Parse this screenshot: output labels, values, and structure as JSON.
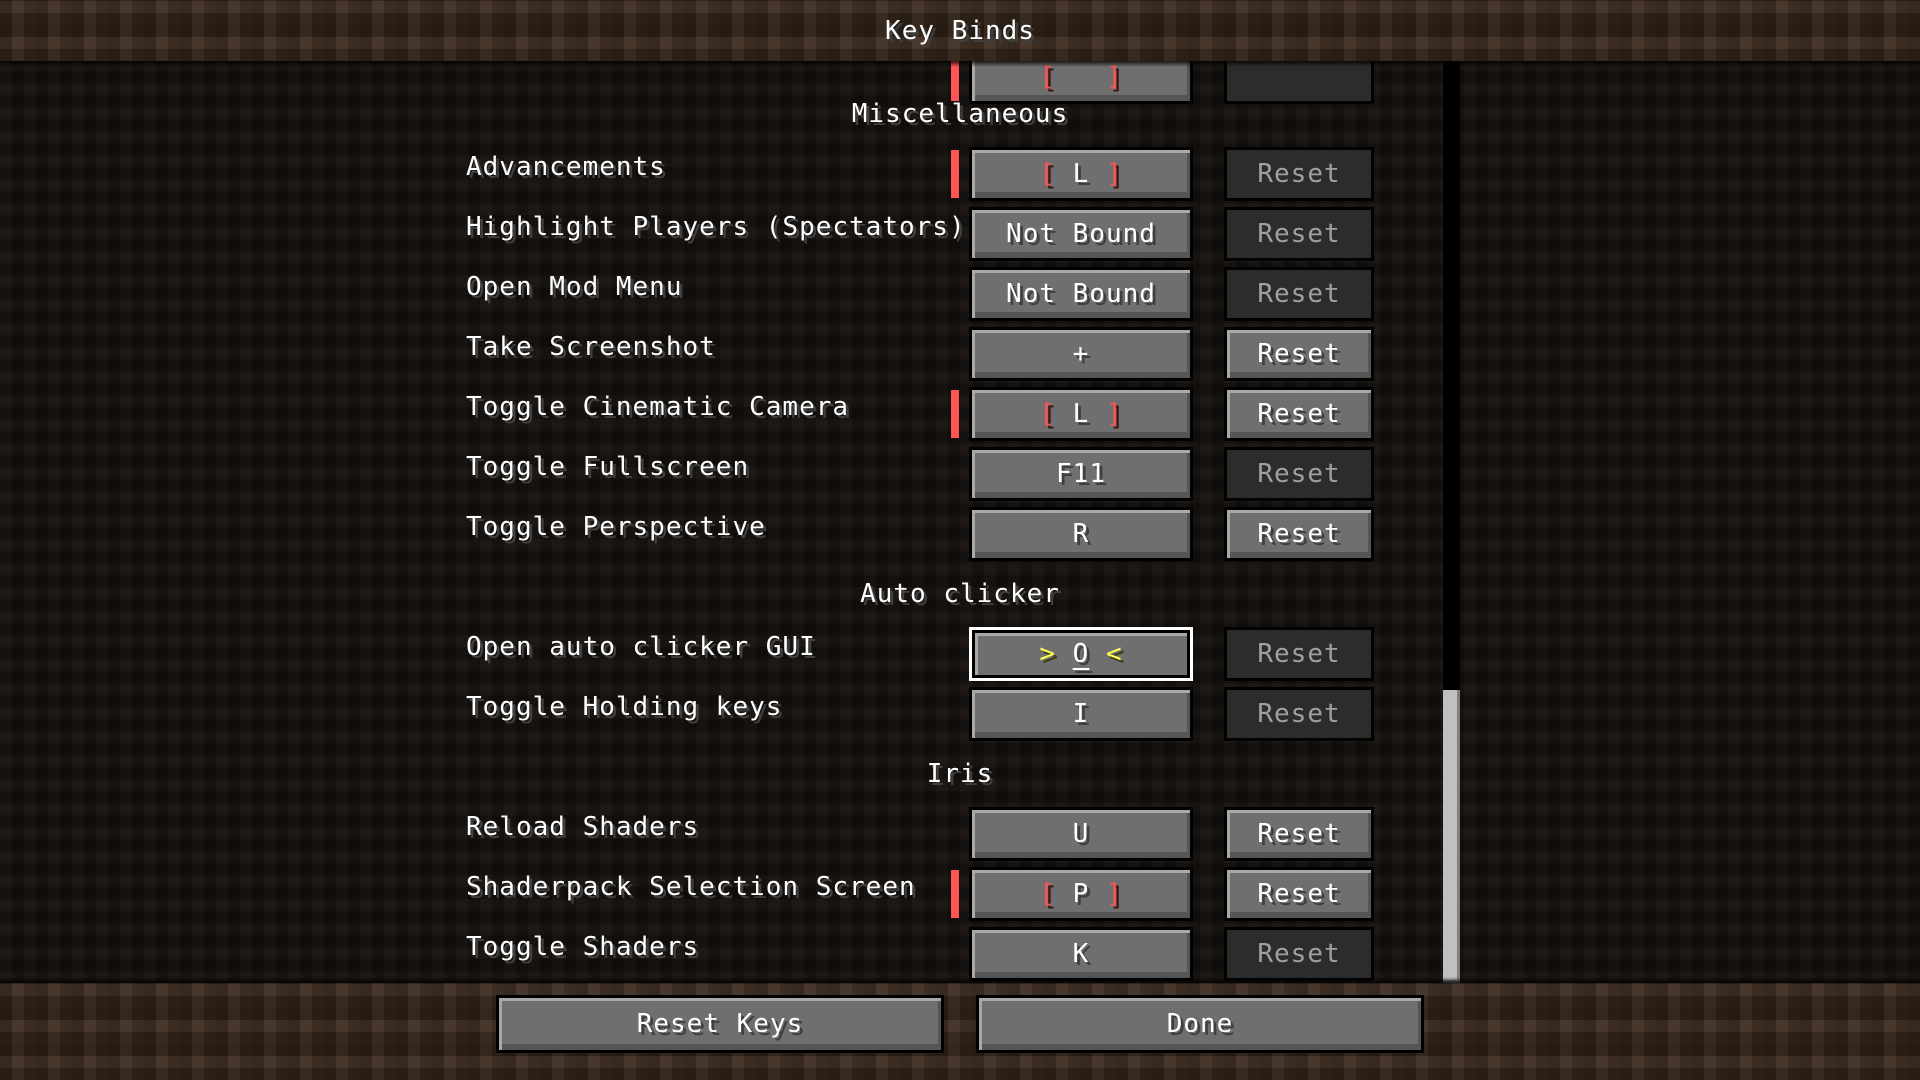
{
  "screen": {
    "title": "Key Binds"
  },
  "partial_row": {
    "key_label": "[ ]",
    "conflict": true
  },
  "categories": [
    {
      "name": "Miscellaneous",
      "bindings": [
        {
          "label": "Advancements",
          "key_parts": [
            "[",
            "L",
            "]"
          ],
          "conflict": true,
          "reset_label": "Reset",
          "reset_enabled": false
        },
        {
          "label": "Highlight Players (Spectators)",
          "key": "Not Bound",
          "conflict": false,
          "reset_label": "Reset",
          "reset_enabled": false
        },
        {
          "label": "Open Mod Menu",
          "key": "Not Bound",
          "conflict": false,
          "reset_label": "Reset",
          "reset_enabled": false
        },
        {
          "label": "Take Screenshot",
          "key": "+",
          "conflict": false,
          "reset_label": "Reset",
          "reset_enabled": true
        },
        {
          "label": "Toggle Cinematic Camera",
          "key_parts": [
            "[",
            "L",
            "]"
          ],
          "conflict": true,
          "reset_label": "Reset",
          "reset_enabled": true
        },
        {
          "label": "Toggle Fullscreen",
          "key": "F11",
          "conflict": false,
          "reset_label": "Reset",
          "reset_enabled": false
        },
        {
          "label": "Toggle Perspective",
          "key": "R",
          "conflict": false,
          "reset_label": "Reset",
          "reset_enabled": true
        }
      ]
    },
    {
      "name": "Auto clicker",
      "bindings": [
        {
          "label": "Open auto clicker GUI",
          "key_parts": [
            ">",
            "O",
            "<"
          ],
          "listening": true,
          "conflict": false,
          "reset_label": "Reset",
          "reset_enabled": false
        },
        {
          "label": "Toggle Holding keys",
          "key": "I",
          "conflict": false,
          "reset_label": "Reset",
          "reset_enabled": false
        }
      ]
    },
    {
      "name": "Iris",
      "bindings": [
        {
          "label": "Reload Shaders",
          "key": "U",
          "conflict": false,
          "reset_label": "Reset",
          "reset_enabled": true
        },
        {
          "label": "Shaderpack Selection Screen",
          "key_parts": [
            "[",
            "P",
            "]"
          ],
          "conflict": true,
          "reset_label": "Reset",
          "reset_enabled": true
        },
        {
          "label": "Toggle Shaders",
          "key": "K",
          "conflict": false,
          "reset_label": "Reset",
          "reset_enabled": false
        }
      ]
    }
  ],
  "footer": {
    "reset_keys_label": "Reset Keys",
    "done_label": "Done"
  },
  "colors": {
    "conflict": "#ff5555",
    "listening_arrow": "#ffff55",
    "button": "#6f6f6f",
    "button_disabled": "#2c2c2c"
  }
}
